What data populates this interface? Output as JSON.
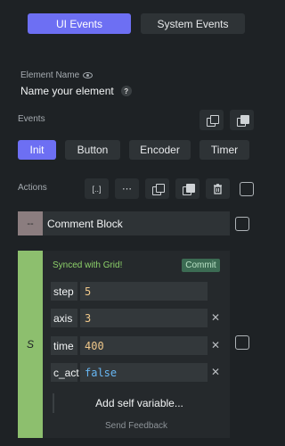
{
  "header": {
    "tabs": [
      {
        "label": "UI Events"
      },
      {
        "label": "System Events"
      }
    ]
  },
  "element": {
    "name_label": "Element Name",
    "name_value": "Name your element",
    "help": "?"
  },
  "events": {
    "label": "Events",
    "tabs": [
      {
        "label": "Init"
      },
      {
        "label": "Button"
      },
      {
        "label": "Encoder"
      },
      {
        "label": "Timer"
      }
    ],
    "selected": "Init"
  },
  "actions": {
    "label": "Actions",
    "merge_glyph": "[..]",
    "dots_glyph": "⋯"
  },
  "comment_block": {
    "tag": "--",
    "title": "Comment Block"
  },
  "code_block": {
    "tag": "S",
    "status": "Synced with Grid!",
    "commit_label": "Commit",
    "vars": [
      {
        "key": "step",
        "value": "5"
      },
      {
        "key": "axis",
        "value": "3"
      },
      {
        "key": "time",
        "value": "400"
      },
      {
        "key": "c_act",
        "value": "false"
      }
    ],
    "add_label": "Add self variable...",
    "delete_glyph": "✕"
  },
  "footer": {
    "feedback": "Send Feedback"
  },
  "colors": {
    "accent": "#6d6ff3",
    "code_tag": "#8dbf6e",
    "synced": "#8dd16a",
    "commit_bg": "#3c6b53",
    "bool": "#68b8f5",
    "number": "#f0c88a"
  }
}
